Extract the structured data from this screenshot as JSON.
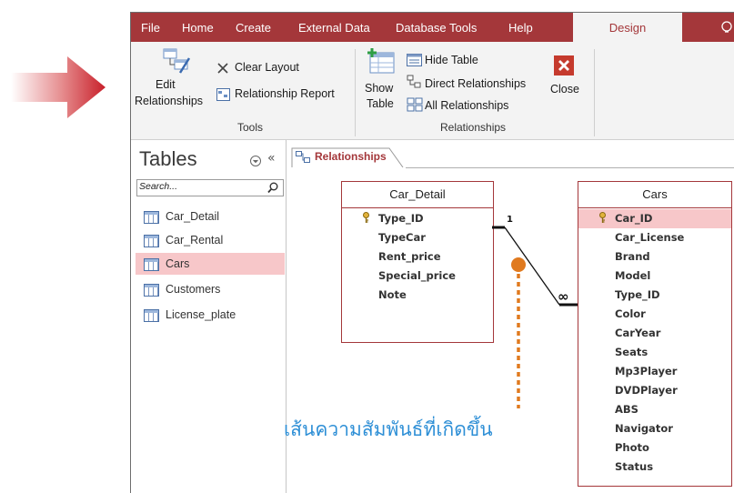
{
  "ribbon": {
    "tabs": [
      "File",
      "Home",
      "Create",
      "External Data",
      "Database Tools",
      "Help",
      "Design"
    ],
    "active_tab": "Design",
    "tools": {
      "edit_relationships_line1": "Edit",
      "edit_relationships_line2": "Relationships",
      "clear_layout": "Clear Layout",
      "relationship_report": "Relationship Report",
      "group_label": "Tools"
    },
    "relationships": {
      "show_table_line1": "Show",
      "show_table_line2": "Table",
      "hide_table": "Hide Table",
      "direct_relationships": "Direct Relationships",
      "all_relationships": "All Relationships",
      "close": "Close",
      "group_label": "Relationships"
    }
  },
  "nav": {
    "title": "Tables",
    "search_placeholder": "Search...",
    "items": [
      "Car_Detail",
      "Car_Rental",
      "Cars",
      "Customers",
      "License_plate"
    ],
    "selected": "Cars"
  },
  "document": {
    "tab_label": "Relationships",
    "tables": [
      {
        "name": "Car_Detail",
        "fields": [
          "Type_ID",
          "TypeCar",
          "Rent_price",
          "Special_price",
          "Note"
        ],
        "key_field": "Type_ID"
      },
      {
        "name": "Cars",
        "fields": [
          "Car_ID",
          "Car_License",
          "Brand",
          "Model",
          "Type_ID",
          "Color",
          "CarYear",
          "Seats",
          "Mp3Player",
          "DVDPlayer",
          "ABS",
          "Navigator",
          "Photo",
          "Status"
        ],
        "key_field": "Car_ID",
        "selected_field": "Car_ID"
      }
    ],
    "relationship": {
      "one_side_label": "1",
      "many_side_label": "∞"
    },
    "annotation": "เส้นความสัมพันธ์ที่เกิดขึ้น"
  },
  "colors": {
    "accent": "#a4373a",
    "selection": "#f7c7c9",
    "annotation_text": "#2e8fd6",
    "annotation_marker": "#e07a1f",
    "arrow": "#c8202a"
  }
}
